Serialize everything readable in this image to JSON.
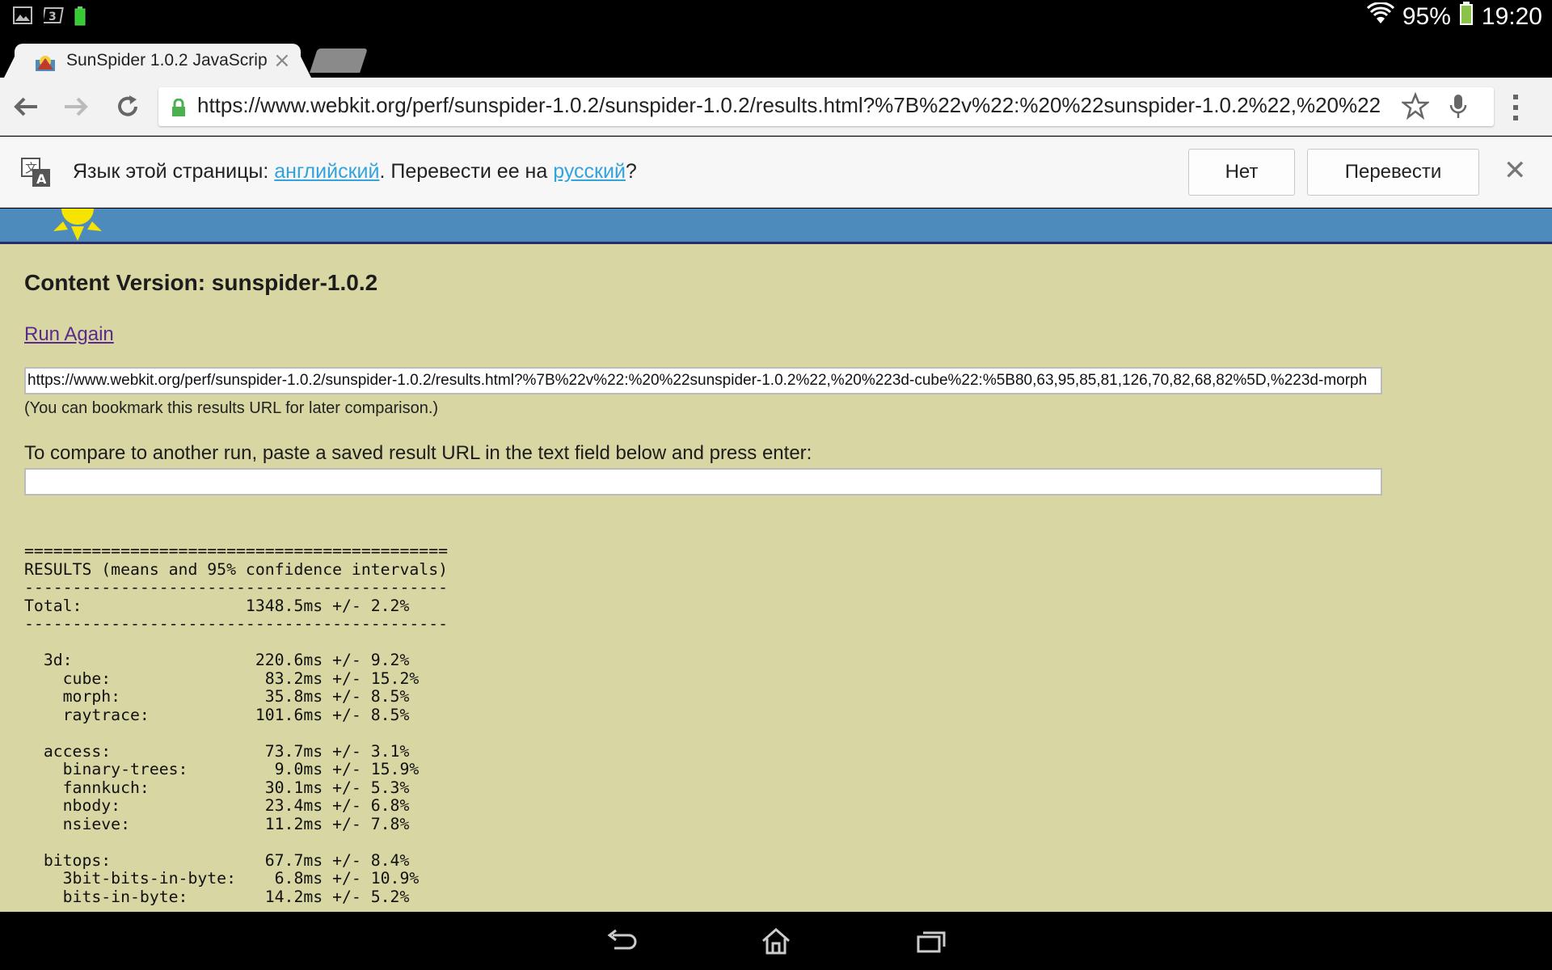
{
  "status_bar": {
    "battery_percent": "95%",
    "time": "19:20",
    "left_icons": [
      "gallery-icon",
      "3g-icon",
      "battery-small-icon"
    ],
    "right_icons": [
      "wifi-icon",
      "battery-icon"
    ]
  },
  "tab": {
    "title": "SunSpider 1.0.2 JavaScrip",
    "close": "×"
  },
  "omnibox": {
    "url": "https://www.webkit.org/perf/sunspider-1.0.2/sunspider-1.0.2/results.html?%7B%22v%22:%20%22sunspider-1.0.2%22,%20%22"
  },
  "translate_bar": {
    "prefix": "Язык этой страницы: ",
    "source_lang": "английский",
    "middle": ". Перевести ее на ",
    "target_lang": "русский",
    "suffix": "?",
    "no_button": "Нет",
    "translate_button": "Перевести",
    "close": "✕"
  },
  "page": {
    "content_version": "Content Version: sunspider-1.0.2",
    "run_again": "Run Again",
    "result_url": "https://www.webkit.org/perf/sunspider-1.0.2/sunspider-1.0.2/results.html?%7B%22v%22:%20%22sunspider-1.0.2%22,%20%223d-cube%22:%5B80,63,95,85,81,126,70,82,68,82%5D,%223d-morph",
    "bookmark_note": "(You can bookmark this results URL for later comparison.)",
    "compare_label": "To compare to another run, paste a saved result URL in the text field below and press enter:",
    "compare_value": "",
    "results_text": "============================================\nRESULTS (means and 95% confidence intervals)\n--------------------------------------------\nTotal:                 1348.5ms +/- 2.2%\n--------------------------------------------\n\n  3d:                   220.6ms +/- 9.2%\n    cube:                83.2ms +/- 15.2%\n    morph:               35.8ms +/- 8.5%\n    raytrace:           101.6ms +/- 8.5%\n\n  access:                73.7ms +/- 3.1%\n    binary-trees:         9.0ms +/- 15.9%\n    fannkuch:            30.1ms +/- 5.3%\n    nbody:               23.4ms +/- 6.8%\n    nsieve:              11.2ms +/- 7.8%\n\n  bitops:                67.7ms +/- 8.4%\n    3bit-bits-in-byte:    6.8ms +/- 10.9%\n    bits-in-byte:        14.2ms +/- 5.2%"
  },
  "colors": {
    "page_bg": "#d8d6a3",
    "banner": "#4e8bbd",
    "link_visited": "#5a2a8c",
    "translate_link": "#33a3dc"
  }
}
